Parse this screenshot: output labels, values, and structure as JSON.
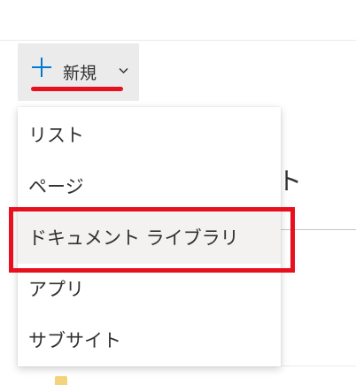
{
  "toolbar": {
    "new_label": "新規",
    "new_icon": "plus-icon",
    "dropdown_icon": "chevron-down-icon",
    "accent_color": "#0078d4"
  },
  "background": {
    "partial_heading": "ト"
  },
  "menu": {
    "items": [
      {
        "label": "リスト"
      },
      {
        "label": "ページ"
      },
      {
        "label": "ドキュメント ライブラリ",
        "highlighted": true
      },
      {
        "label": "アプリ"
      },
      {
        "label": "サブサイト"
      }
    ]
  },
  "annotations": {
    "highlight_color": "#e8101e"
  }
}
